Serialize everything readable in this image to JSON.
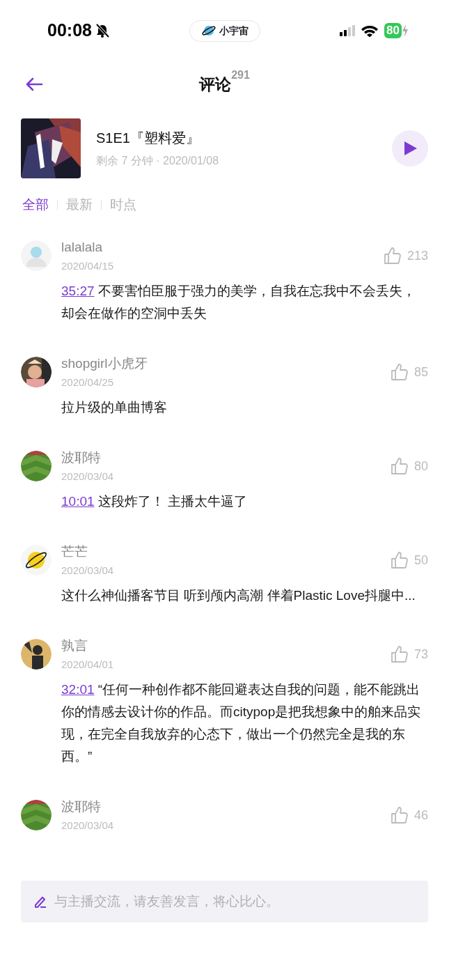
{
  "status_bar": {
    "time": "00:08",
    "app_pill": "小宇宙",
    "battery": "80"
  },
  "header": {
    "title": "评论",
    "count": "291"
  },
  "episode": {
    "title": "S1E1『塑料爱』",
    "meta": "剩余 7 分钟 · 2020/01/08"
  },
  "tabs": [
    {
      "label": "全部",
      "selected": true
    },
    {
      "label": "最新",
      "selected": false
    },
    {
      "label": "时点",
      "selected": false
    }
  ],
  "comments": [
    {
      "avatar": {
        "kind": "silhouette"
      },
      "user": "lalalala",
      "date": "2020/04/15",
      "likes": "213",
      "timestamp": "35:27",
      "text": "不要害怕臣服于强力的美学，自我在忘我中不会丢失，却会在做作的空洞中丢失"
    },
    {
      "user": "shopgirl小虎牙",
      "date": "2020/04/25",
      "likes": "85",
      "text": "拉片级的单曲博客"
    },
    {
      "user": "波耶特",
      "date": "2020/03/04",
      "likes": "80",
      "timestamp": "10:01",
      "text": "这段炸了！ 主播太牛逼了"
    },
    {
      "user": "芒芒",
      "date": "2020/03/04",
      "likes": "50",
      "text": "这什么神仙播客节目 听到颅内高潮 伴着Plastic Love抖腿中..."
    },
    {
      "user": "孰言",
      "date": "2020/04/01",
      "likes": "73",
      "timestamp": "32:01",
      "text": "“任何一种创作都不能回避表达自我的问题，能不能跳出你的情感去设计你的作品。而citypop是把我想象中的舶来品实现，在完全自我放弃的心态下，做出一个仍然完全是我的东西。”"
    },
    {
      "user": "波耶特",
      "date": "2020/03/04",
      "likes": "46"
    }
  ],
  "composer": {
    "placeholder": "与主播交流，请友善发言，将心比心。"
  }
}
